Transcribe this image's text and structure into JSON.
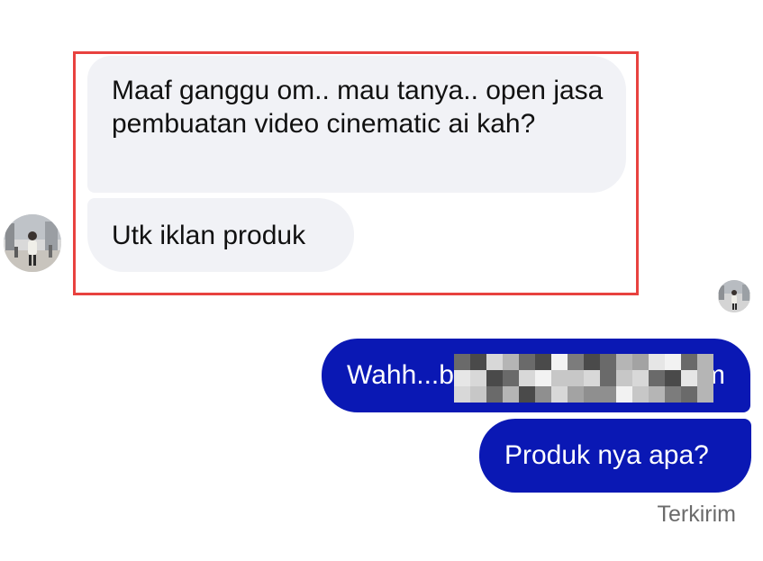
{
  "conversation": {
    "incoming": [
      {
        "text": "Maaf ganggu om.. mau tanya.. open jasa pembuatan video cinematic ai kah?"
      },
      {
        "text": "Utk iklan produk"
      }
    ],
    "outgoing": [
      {
        "text": "Wahh...b",
        "text_tail": "m",
        "redacted": true
      },
      {
        "text": "Produk nya apa?"
      }
    ],
    "status": "Terkirim"
  },
  "colors": {
    "incoming_bubble": "#f1f2f6",
    "outgoing_bubble": "#0a18b4",
    "highlight_border": "#e8423f",
    "status_text": "#6b6b6b"
  },
  "icons": {
    "contact_avatar": "contact-avatar",
    "seen_indicator": "seen-avatar-icon"
  }
}
